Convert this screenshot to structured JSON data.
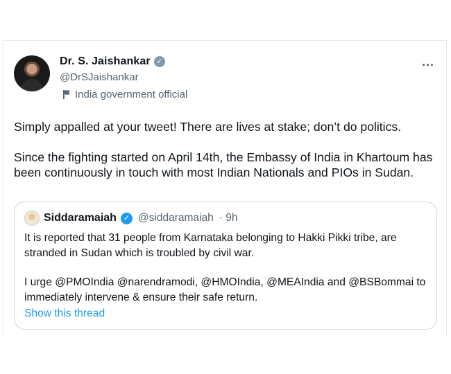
{
  "tweet": {
    "author": {
      "name": "Dr. S. Jaishankar",
      "handle": "@DrSJaishankar",
      "affiliation": "India government official",
      "badge_color": "#829aab"
    },
    "more_icon": "...",
    "paragraphs": [
      "Simply appalled at your tweet! There are lives at stake; don’t do politics.",
      "Since the fighting started on April 14th, the Embassy of India in Khartoum has been continuously in touch with most Indian Nationals and PIOs in Sudan."
    ]
  },
  "quote": {
    "author": {
      "name": "Siddaramaiah",
      "handle": "@siddaramaiah",
      "time": "· 9h",
      "badge_color": "#1d9bf0"
    },
    "paragraphs": [
      "It is reported that 31 people from Karnataka belonging to Hakki Pikki tribe, are stranded in Sudan which is troubled by civil war.",
      "I urge @PMOIndia @narendramodi, @HMOIndia, @MEAIndia and @BSBommai to immediately intervene & ensure their safe return."
    ],
    "show_thread": "Show this thread"
  }
}
